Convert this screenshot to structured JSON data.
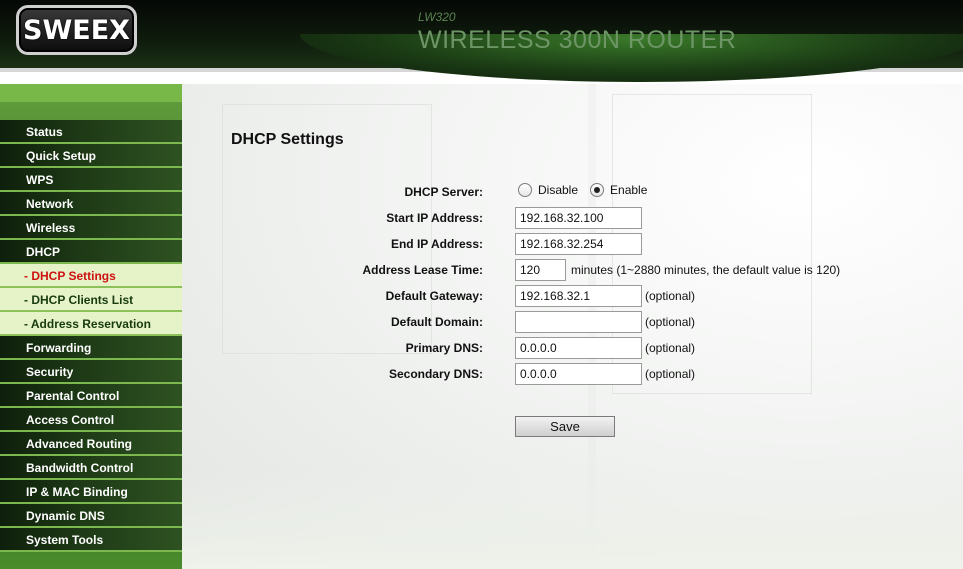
{
  "header": {
    "logo_text": "SWEEX",
    "model": "LW320",
    "product": "WIRELESS 300N ROUTER"
  },
  "sidebar": {
    "items": [
      {
        "label": "Status",
        "type": "main"
      },
      {
        "label": "Quick Setup",
        "type": "main"
      },
      {
        "label": "WPS",
        "type": "main"
      },
      {
        "label": "Network",
        "type": "main"
      },
      {
        "label": "Wireless",
        "type": "main"
      },
      {
        "label": "DHCP",
        "type": "main"
      },
      {
        "label": "- DHCP Settings",
        "type": "sub",
        "active": true
      },
      {
        "label": "- DHCP Clients List",
        "type": "sub"
      },
      {
        "label": "- Address Reservation",
        "type": "sub"
      },
      {
        "label": "Forwarding",
        "type": "main"
      },
      {
        "label": "Security",
        "type": "main"
      },
      {
        "label": "Parental Control",
        "type": "main"
      },
      {
        "label": "Access Control",
        "type": "main"
      },
      {
        "label": "Advanced Routing",
        "type": "main"
      },
      {
        "label": "Bandwidth Control",
        "type": "main"
      },
      {
        "label": "IP & MAC Binding",
        "type": "main"
      },
      {
        "label": "Dynamic DNS",
        "type": "main"
      },
      {
        "label": "System Tools",
        "type": "main"
      }
    ]
  },
  "main": {
    "title": "DHCP Settings",
    "dhcp_server": {
      "label": "DHCP Server:",
      "options": [
        "Disable",
        "Enable"
      ],
      "selected": "Enable"
    },
    "start_ip": {
      "label": "Start IP Address:",
      "value": "192.168.32.100"
    },
    "end_ip": {
      "label": "End IP Address:",
      "value": "192.168.32.254"
    },
    "lease_time": {
      "label": "Address Lease Time:",
      "value": "120",
      "note": "minutes (1~2880 minutes, the default value is 120)"
    },
    "gateway": {
      "label": "Default Gateway:",
      "value": "192.168.32.1",
      "note": "(optional)"
    },
    "domain": {
      "label": "Default Domain:",
      "value": "",
      "note": "(optional)"
    },
    "primary_dns": {
      "label": "Primary DNS:",
      "value": "0.0.0.0",
      "note": "(optional)"
    },
    "secondary_dns": {
      "label": "Secondary DNS:",
      "value": "0.0.0.0",
      "note": "(optional)"
    },
    "save_label": "Save"
  },
  "colors": {
    "active_submenu_text": "#cc1111",
    "submenu_background": "#e6f3c8",
    "menu_background": "#1e3a16"
  }
}
